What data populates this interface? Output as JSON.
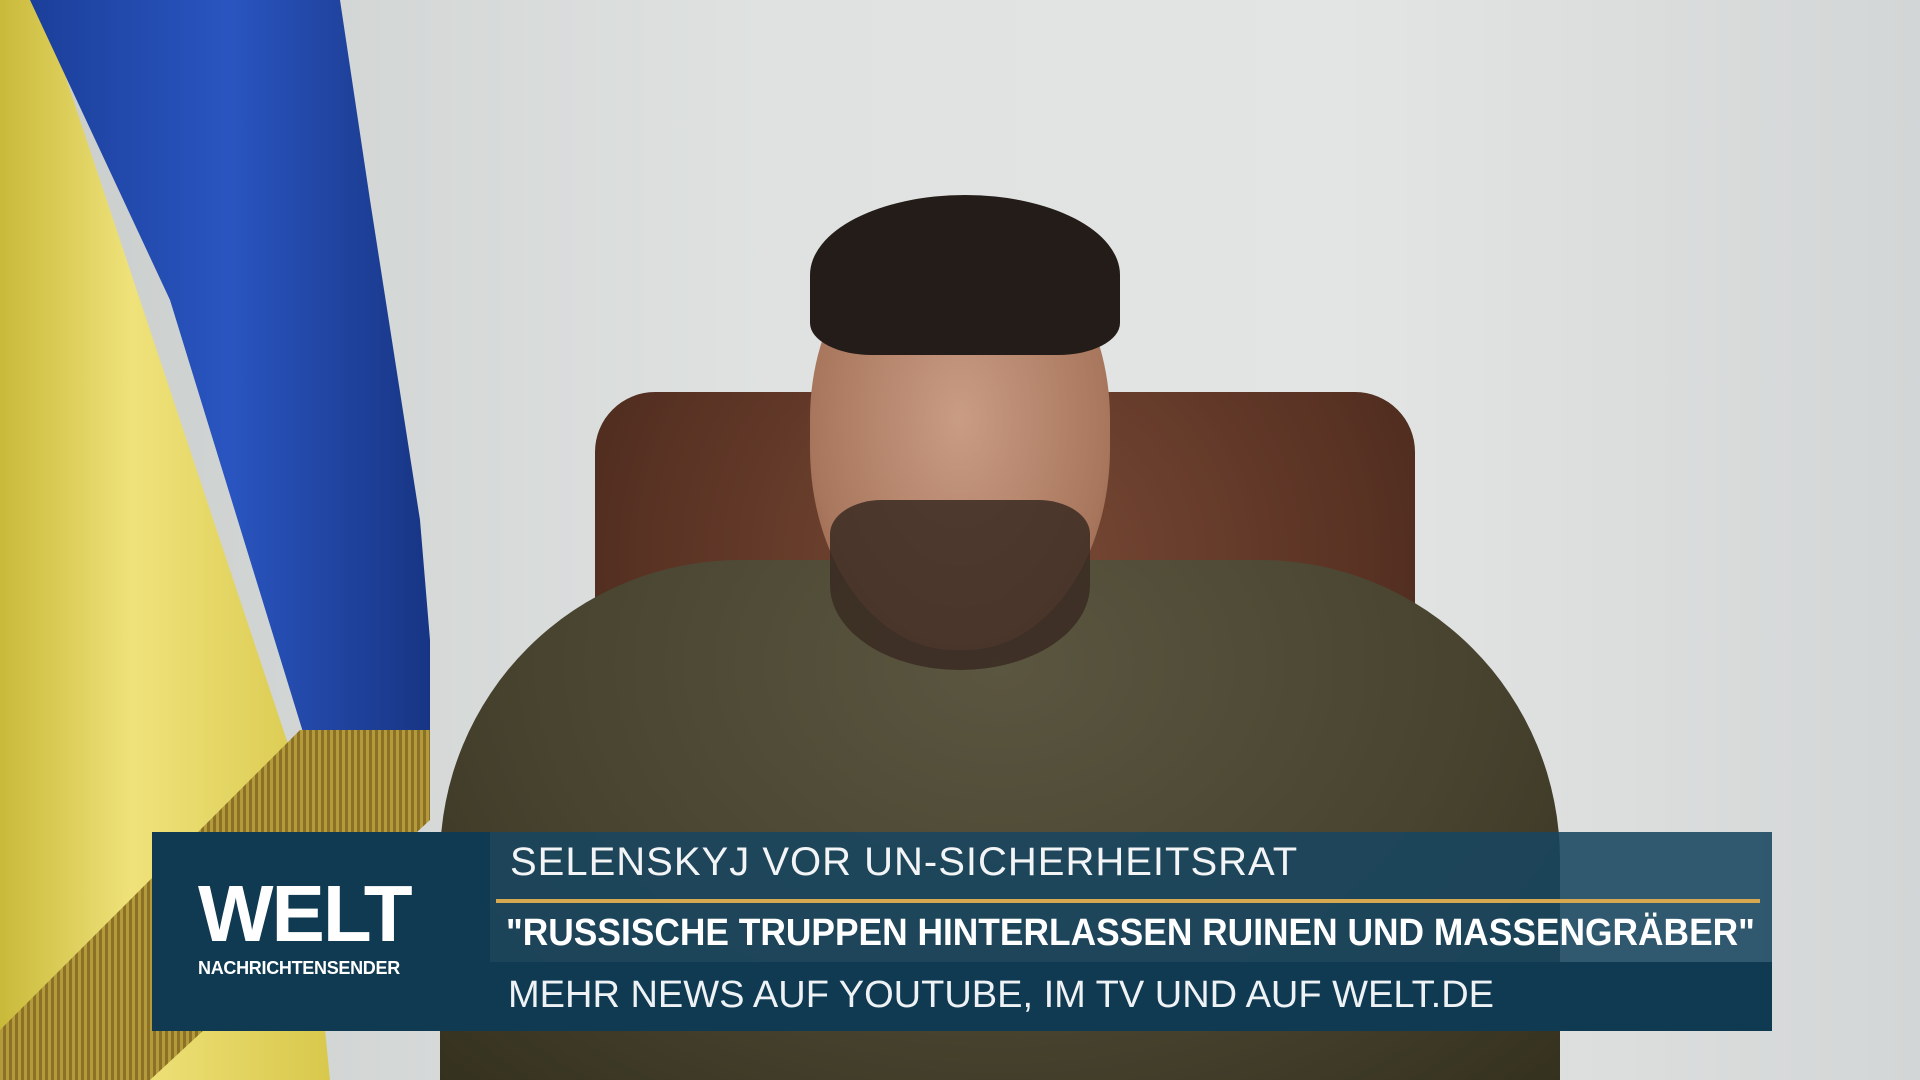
{
  "logo": {
    "brand": "WELT",
    "subtitle": "NACHRICHTENSENDER"
  },
  "lower_third": {
    "topline": "SELENSKYJ VOR UN-SICHERHEITSRAT",
    "headline": "\"RUSSISCHE TRUPPEN HINTERLASSEN RUINEN UND MASSENGRÄBER\"",
    "ticker": "MEHR NEWS AUF YOUTUBE, IM TV UND AUF WELT.DE"
  },
  "colors": {
    "panel": "#0f3a52",
    "accent_line": "#d6a84f"
  }
}
